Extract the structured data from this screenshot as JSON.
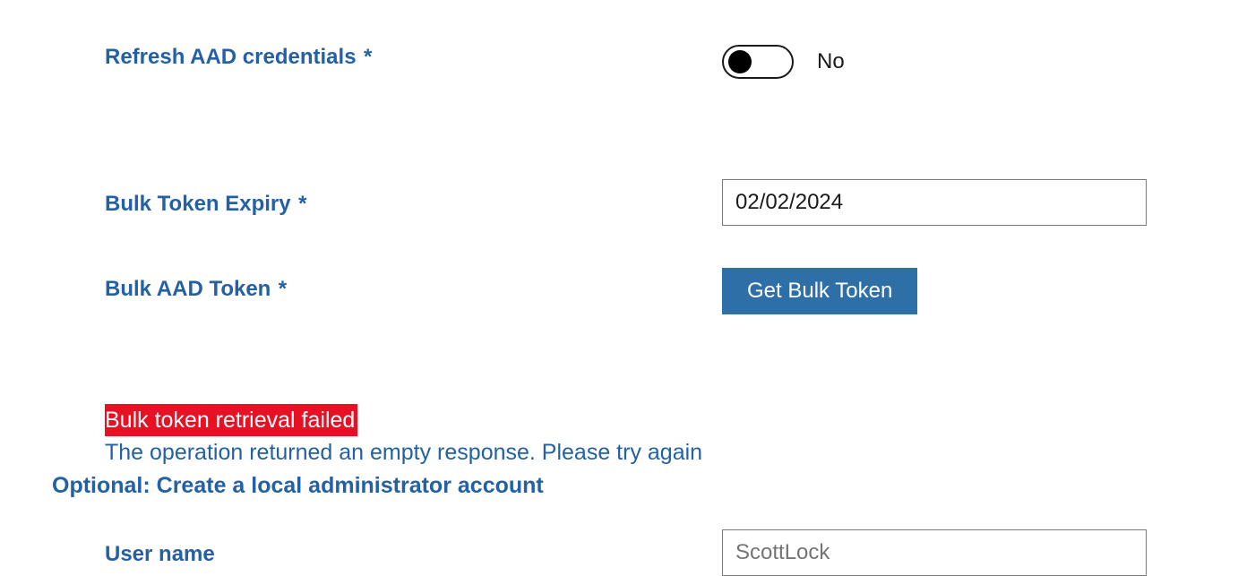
{
  "fields": {
    "refresh": {
      "label": "Refresh AAD credentials",
      "asterisk": "*",
      "toggle_value": "No"
    },
    "expiry": {
      "label": "Bulk Token Expiry",
      "asterisk": "*",
      "value": "02/02/2024"
    },
    "bulk_token": {
      "label": "Bulk AAD Token",
      "asterisk": "*",
      "button_label": "Get Bulk Token"
    },
    "username": {
      "label": "User name",
      "placeholder": "ScottLock"
    }
  },
  "error": {
    "title": "Bulk token retrieval failed",
    "detail": "The operation returned an empty response. Please try again"
  },
  "optional_heading": "Optional: Create a local administrator account"
}
